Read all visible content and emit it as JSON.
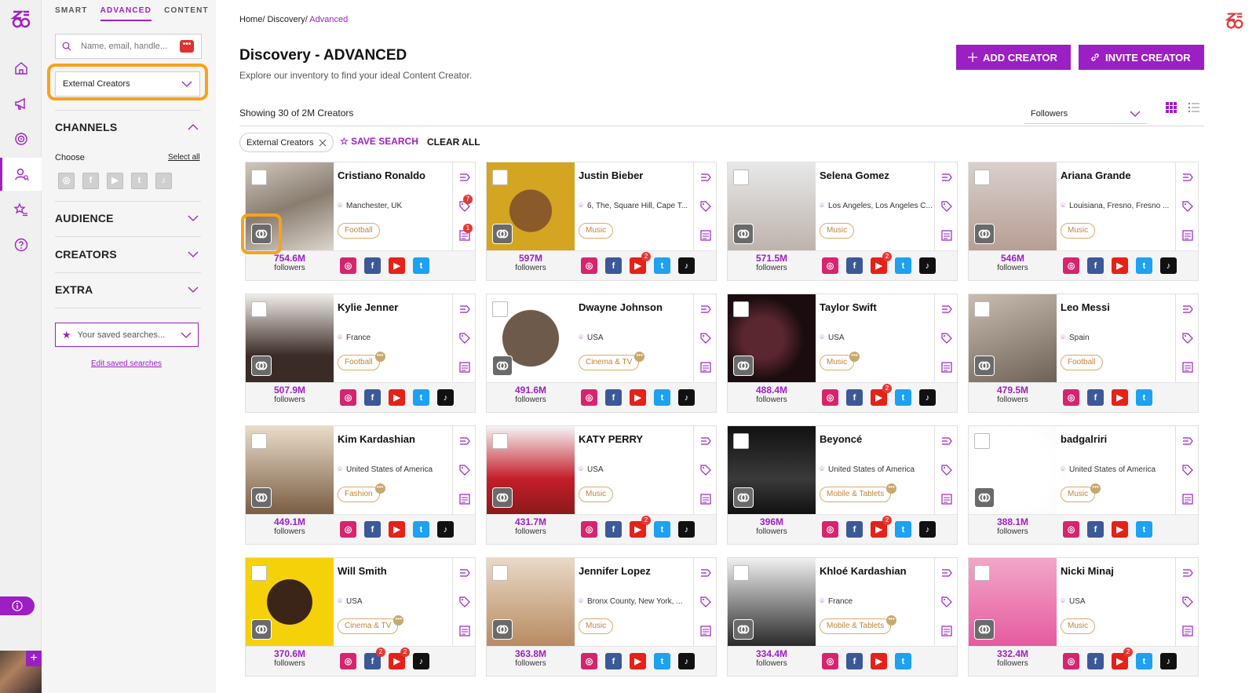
{
  "filters": {
    "tabs": [
      "SMART",
      "ADVANCED",
      "CONTENT"
    ],
    "search_placeholder": "Name, email, handle...",
    "source_select": "External Creators",
    "sections": [
      "CHANNELS",
      "AUDIENCE",
      "CREATORS",
      "EXTRA"
    ],
    "choose_label": "Choose",
    "select_all": "Select all",
    "saved_searches_placeholder": "Your saved searches...",
    "edit_saved": "Edit saved searches"
  },
  "header": {
    "breadcrumb": [
      "Home",
      "Discovery",
      "Advanced"
    ],
    "title": "Discovery - ADVANCED",
    "subtitle": "Explore our inventory to find your ideal Content Creator.",
    "add_creator": "ADD CREATOR",
    "invite_creator": "INVITE CREATOR"
  },
  "results": {
    "showing": "Showing 30 of 2M Creators",
    "sort_by": "Followers",
    "chip": "External Creators",
    "save_search": "SAVE SEARCH",
    "clear_all": "CLEAR ALL",
    "followers_label": "followers"
  },
  "colors": {
    "accent": "#9b1fc3",
    "highlight": "#f7a21b"
  },
  "creators": [
    {
      "name": "Cristiano Ronaldo",
      "location": "Manchester, UK",
      "tag": "Football",
      "tag_dot": false,
      "followers": "754.6M",
      "channels": [
        "ig",
        "fb",
        "yt",
        "tw"
      ],
      "yt_badge": "",
      "fb_badge": "",
      "tag_notif": "7",
      "note_notif": "1"
    },
    {
      "name": "Justin Bieber",
      "location": "6, The, Square Hill, Cape T...",
      "tag": "Music",
      "tag_dot": false,
      "followers": "597M",
      "channels": [
        "ig",
        "fb",
        "yt",
        "tw",
        "tt"
      ],
      "yt_badge": "2",
      "fb_badge": "",
      "tag_notif": "",
      "note_notif": ""
    },
    {
      "name": "Selena Gomez",
      "location": "Los Angeles, Los Angeles C...",
      "tag": "Music",
      "tag_dot": false,
      "followers": "571.5M",
      "channels": [
        "ig",
        "fb",
        "yt",
        "tw",
        "tt"
      ],
      "yt_badge": "2",
      "fb_badge": "",
      "tag_notif": "",
      "note_notif": ""
    },
    {
      "name": "Ariana Grande",
      "location": "Louisiana, Fresno, Fresno ...",
      "tag": "Music",
      "tag_dot": false,
      "followers": "546M",
      "channels": [
        "ig",
        "fb",
        "yt",
        "tw",
        "tt"
      ],
      "yt_badge": "",
      "fb_badge": "",
      "tag_notif": "",
      "note_notif": ""
    },
    {
      "name": "Kylie Jenner",
      "location": "France",
      "tag": "Football",
      "tag_dot": true,
      "followers": "507.9M",
      "channels": [
        "ig",
        "fb",
        "yt",
        "tw",
        "tt"
      ],
      "yt_badge": "",
      "fb_badge": "",
      "tag_notif": "",
      "note_notif": ""
    },
    {
      "name": "Dwayne Johnson",
      "location": "USA",
      "tag": "Cinema & TV",
      "tag_dot": true,
      "followers": "491.6M",
      "channels": [
        "ig",
        "fb",
        "yt",
        "tw",
        "tt"
      ],
      "yt_badge": "",
      "fb_badge": "",
      "tag_notif": "",
      "note_notif": ""
    },
    {
      "name": "Taylor Swift",
      "location": "USA",
      "tag": "Music",
      "tag_dot": true,
      "followers": "488.4M",
      "channels": [
        "ig",
        "fb",
        "yt",
        "tw",
        "tt"
      ],
      "yt_badge": "2",
      "fb_badge": "",
      "tag_notif": "",
      "note_notif": ""
    },
    {
      "name": "Leo Messi",
      "location": "Spain",
      "tag": "Football",
      "tag_dot": false,
      "followers": "479.5M",
      "channels": [
        "ig",
        "fb",
        "yt",
        "tw"
      ],
      "yt_badge": "",
      "fb_badge": "",
      "tag_notif": "",
      "note_notif": ""
    },
    {
      "name": "Kim Kardashian",
      "location": "United States of America",
      "tag": "Fashion",
      "tag_dot": true,
      "followers": "449.1M",
      "channels": [
        "ig",
        "fb",
        "yt",
        "tw",
        "tt"
      ],
      "yt_badge": "",
      "fb_badge": "",
      "tag_notif": "",
      "note_notif": ""
    },
    {
      "name": "KATY PERRY",
      "location": "USA",
      "tag": "Music",
      "tag_dot": false,
      "followers": "431.7M",
      "channels": [
        "ig",
        "fb",
        "yt",
        "tw",
        "tt"
      ],
      "yt_badge": "2",
      "fb_badge": "",
      "tag_notif": "",
      "note_notif": ""
    },
    {
      "name": "Beyoncé",
      "location": "United States of America",
      "tag": "Mobile & Tablets",
      "tag_dot": true,
      "followers": "396M",
      "channels": [
        "ig",
        "fb",
        "yt",
        "tw",
        "tt"
      ],
      "yt_badge": "2",
      "fb_badge": "",
      "tag_notif": "",
      "note_notif": ""
    },
    {
      "name": "badgalriri",
      "location": "United States of America",
      "tag": "Music",
      "tag_dot": true,
      "followers": "388.1M",
      "channels": [
        "ig",
        "fb",
        "yt",
        "tw"
      ],
      "yt_badge": "",
      "fb_badge": "",
      "tag_notif": "",
      "note_notif": ""
    },
    {
      "name": "Will Smith",
      "location": "USA",
      "tag": "Cinema & TV",
      "tag_dot": true,
      "followers": "370.6M",
      "channels": [
        "ig",
        "fb",
        "yt",
        "tt"
      ],
      "yt_badge": "2",
      "fb_badge": "2",
      "tag_notif": "",
      "note_notif": ""
    },
    {
      "name": "Jennifer Lopez",
      "location": "Bronx County, New York, ...",
      "tag": "Music",
      "tag_dot": false,
      "followers": "363.8M",
      "channels": [
        "ig",
        "fb",
        "yt",
        "tw",
        "tt"
      ],
      "yt_badge": "",
      "fb_badge": "",
      "tag_notif": "",
      "note_notif": ""
    },
    {
      "name": "Khloé Kardashian",
      "location": "France",
      "tag": "Mobile & Tablets",
      "tag_dot": true,
      "followers": "334.4M",
      "channels": [
        "ig",
        "fb",
        "yt",
        "tw"
      ],
      "yt_badge": "",
      "fb_badge": "",
      "tag_notif": "",
      "note_notif": ""
    },
    {
      "name": "Nicki Minaj",
      "location": "USA",
      "tag": "Music",
      "tag_dot": false,
      "followers": "332.4M",
      "channels": [
        "ig",
        "fb",
        "yt",
        "tw",
        "tt"
      ],
      "yt_badge": "2",
      "fb_badge": "",
      "tag_notif": "",
      "note_notif": ""
    }
  ]
}
